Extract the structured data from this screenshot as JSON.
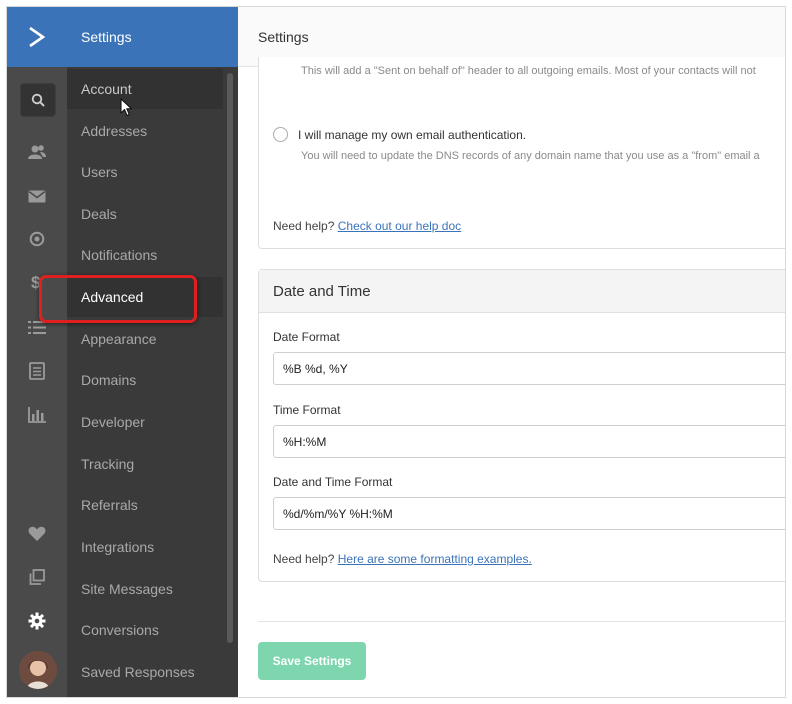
{
  "nav": {
    "header": "Settings",
    "items": [
      {
        "label": "Account"
      },
      {
        "label": "Addresses"
      },
      {
        "label": "Users"
      },
      {
        "label": "Deals"
      },
      {
        "label": "Notifications"
      },
      {
        "label": "Advanced"
      },
      {
        "label": "Appearance"
      },
      {
        "label": "Domains"
      },
      {
        "label": "Developer"
      },
      {
        "label": "Tracking"
      },
      {
        "label": "Referrals"
      },
      {
        "label": "Integrations"
      },
      {
        "label": "Site Messages"
      },
      {
        "label": "Conversions"
      },
      {
        "label": "Saved Responses"
      }
    ],
    "active_item": "Advanced"
  },
  "rail": {
    "icons": [
      "logo-chevron-icon",
      "search-icon",
      "contacts-icon",
      "mail-icon",
      "target-icon",
      "dollar-icon",
      "list-icon",
      "document-icon",
      "bar-chart-icon",
      "heart-icon",
      "copy-icon",
      "gear-icon"
    ]
  },
  "main": {
    "header_title": "Settings",
    "auth": {
      "sent_on_behalf_text": "This will add a \"Sent on behalf of\" header to all outgoing emails. Most of your contacts will not",
      "manage_own_label": "I will manage my own email authentication.",
      "manage_own_desc": "You will need to update the DNS records of any domain name that you use as a \"from\" email a",
      "help_prefix": "Need help?",
      "help_link": "Check out our help doc"
    },
    "date_time": {
      "section_title": "Date and Time",
      "date_format_label": "Date Format",
      "date_format_value": "%B %d, %Y",
      "time_format_label": "Time Format",
      "time_format_value": "%H:%M",
      "date_time_format_label": "Date and Time Format",
      "date_time_format_value": "%d/%m/%Y %H:%M",
      "help_prefix": "Need help?",
      "help_link": "Here are some formatting examples."
    },
    "save_label": "Save Settings"
  },
  "colors": {
    "brand_blue": "#3b73b9",
    "rail_bg": "#4a4a4a",
    "nav_bg": "#3a3a3a",
    "save_button": "#7dd6ae",
    "highlight": "#e02020"
  }
}
